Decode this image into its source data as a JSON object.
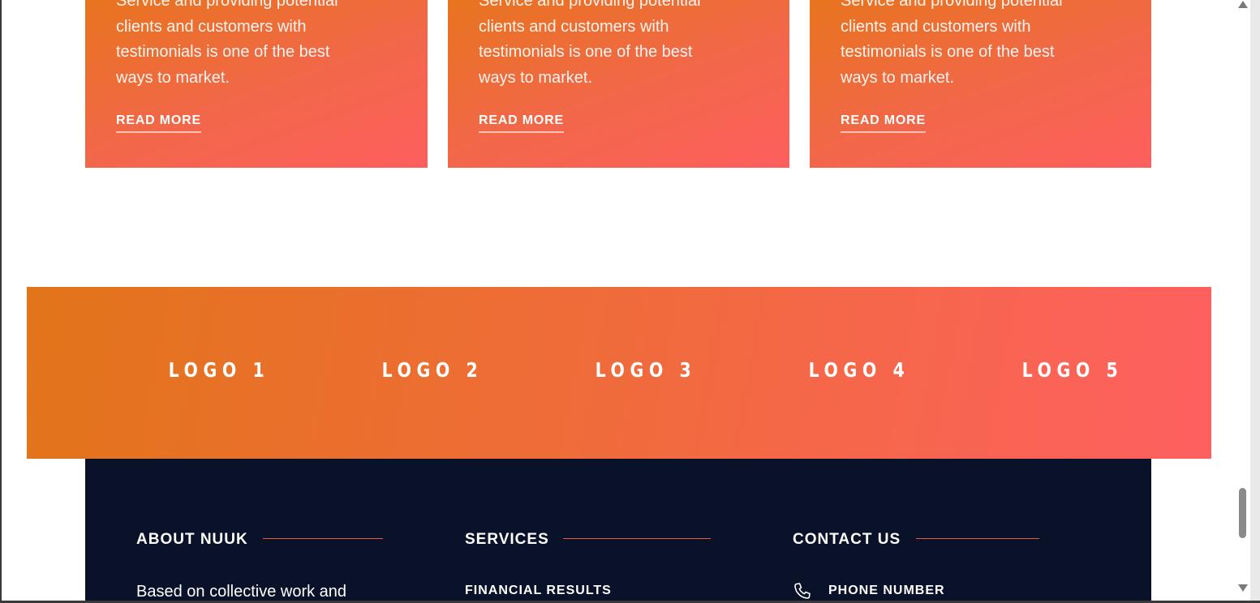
{
  "cards": [
    {
      "text": "Service and providing potential clients and customers with testimonials is one of the best ways to market.",
      "link": "READ MORE"
    },
    {
      "text": "Service and providing potential clients and customers with testimonials is one of the best ways to market.",
      "link": "READ MORE"
    },
    {
      "text": "Service and providing potential clients and customers with testimonials is one of the best ways to market.",
      "link": "READ MORE"
    }
  ],
  "logos": [
    "LOGO 1",
    "LOGO 2",
    "LOGO 3",
    "LOGO 4",
    "LOGO 5"
  ],
  "footer": {
    "about": {
      "heading": "ABOUT NUUK",
      "text": "Based on collective work and"
    },
    "services": {
      "heading": "SERVICES",
      "items": [
        "FINANCIAL RESULTS"
      ]
    },
    "contact": {
      "heading": "CONTACT US",
      "items": [
        {
          "icon": "phone-icon",
          "label": "PHONE NUMBER"
        }
      ]
    }
  },
  "colors": {
    "card_gradient_start": "#e8741e",
    "card_gradient_end": "#fe5f5e",
    "band_gradient_start": "#e2741a",
    "band_gradient_end": "#fe6060",
    "footer_background": "#0a1229",
    "heading_rule": "#e8593f"
  }
}
